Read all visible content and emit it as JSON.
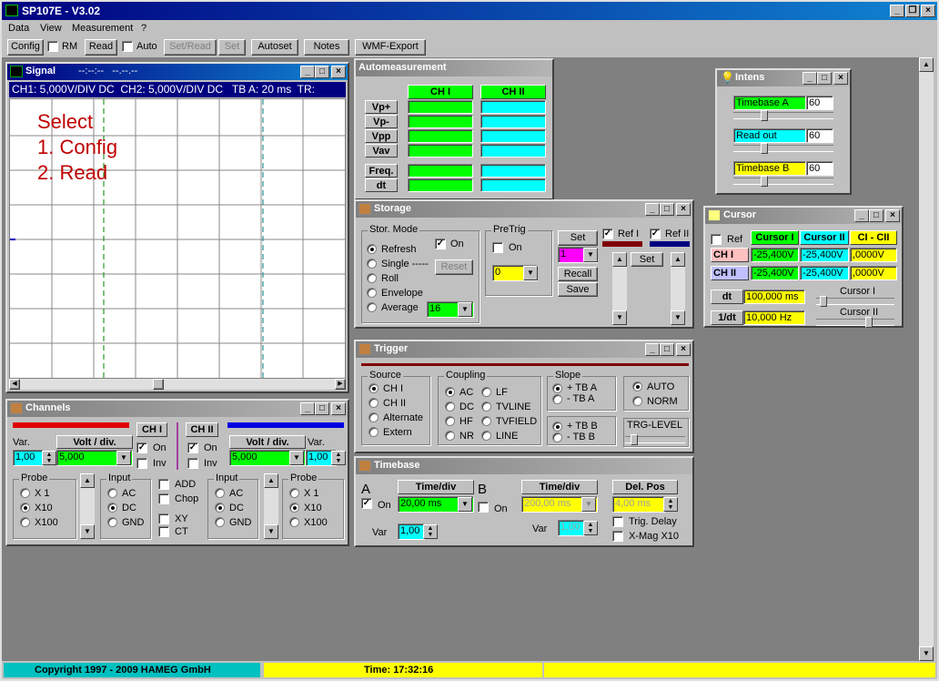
{
  "app": {
    "title": "SP107E - V3.02"
  },
  "menu": [
    "Data",
    "View",
    "Measurement",
    "?"
  ],
  "toolbar": {
    "config": "Config",
    "rm": "RM",
    "read": "Read",
    "auto": "Auto",
    "set_read": "Set/Read",
    "set": "Set",
    "autoset": "Autoset",
    "notes": "Notes",
    "wmf": "WMF-Export"
  },
  "signal": {
    "title": "Signal",
    "cursor_readout": "--:--:--   --.--.--",
    "info": "CH1: 5,000V/DIV DC  CH2: 5,000V/DIV DC   TB A: 20 ms  TR:",
    "instructions": [
      "Select",
      "1. Config",
      "2. Read"
    ]
  },
  "auto": {
    "title": "Automeasurement",
    "ch1": "CH I",
    "ch2": "CH II",
    "rows": [
      "Vp+",
      "Vp-",
      "Vpp",
      "Vav"
    ],
    "rows2": [
      "Freq.",
      "dt"
    ]
  },
  "intens": {
    "title": "Intens",
    "items": [
      {
        "label": "Timebase A",
        "value": "60",
        "color": "#00ff00"
      },
      {
        "label": "Read out",
        "value": "60",
        "color": "#00ffff"
      },
      {
        "label": "Timebase B",
        "value": "60",
        "color": "#ffff00"
      }
    ]
  },
  "storage": {
    "title": "Storage",
    "mode_label": "Stor. Mode",
    "modes": [
      "Refresh",
      "Single -----",
      "Roll",
      "Envelope",
      "Average"
    ],
    "on": "On",
    "reset": "Reset",
    "average_value": "16",
    "pretrig_label": "PreTrig",
    "pretrig_on": "On",
    "pretrig_value": "0",
    "set": "Set",
    "ref_select": "1",
    "recall": "Recall",
    "save": "Save",
    "ref1": "Ref I",
    "ref2": "Ref II",
    "ref_set": "Set"
  },
  "cursor": {
    "title": "Cursor",
    "ref": "Ref",
    "cursor1": "Cursor I",
    "cursor2": "Cursor II",
    "diff": "CI - CII",
    "rows": [
      {
        "label": "CH I",
        "c1": "-25,400V",
        "c2": "-25,400V",
        "d": ",0000V"
      },
      {
        "label": "CH II",
        "c1": "-25,400V",
        "c2": "-25,400V",
        "d": ",0000V"
      }
    ],
    "dt_label": "dt",
    "dt_value": "100,000 ms",
    "inv_label": "1/dt",
    "inv_value": "10,000 Hz",
    "slider1": "Cursor I",
    "slider2": "Cursor II"
  },
  "trigger": {
    "title": "Trigger",
    "source_label": "Source",
    "sources": [
      "CH I",
      "CH II",
      "Alternate",
      "Extern"
    ],
    "coupling_label": "Coupling",
    "coupling": [
      "AC",
      "LF",
      "DC",
      "TVLINE",
      "HF",
      "TVFIELD",
      "NR",
      "LINE"
    ],
    "slope_label": "Slope",
    "slope_a": [
      "+ TB A",
      "- TB A"
    ],
    "slope_b": [
      "+ TB B",
      "- TB B"
    ],
    "modes": [
      "AUTO",
      "NORM"
    ],
    "level": "TRG-LEVEL"
  },
  "channels": {
    "title": "Channels",
    "var": "Var.",
    "volt_div": "Volt / div.",
    "ch1": "CH I",
    "ch2": "CH II",
    "var1": "1,00",
    "volt1": "5,000",
    "var2": "1,00",
    "volt2": "5,000",
    "on": "On",
    "inv": "Inv",
    "probe": "Probe",
    "probes": [
      "X 1",
      "X10",
      "X100"
    ],
    "input": "Input",
    "inputs": [
      "AC",
      "DC",
      "GND"
    ],
    "add": "ADD",
    "chop": "Chop",
    "xy": "XY",
    "ct": "CT"
  },
  "timebase": {
    "title": "Timebase",
    "a": "A",
    "b": "B",
    "on": "On",
    "time_div": "Time/div",
    "a_value": "20,00 ms",
    "b_value": "200,00 ms",
    "del_pos": "Del. Pos",
    "del_value": "4,00 ms",
    "var": "Var",
    "var_a": "1,00",
    "var_b": "1,00",
    "trig_delay": "Trig. Delay",
    "xmag": "X-Mag X10"
  },
  "status": {
    "copyright": "Copyright 1997 - 2009 HAMEG GmbH",
    "time": "Time: 17:32:16"
  }
}
